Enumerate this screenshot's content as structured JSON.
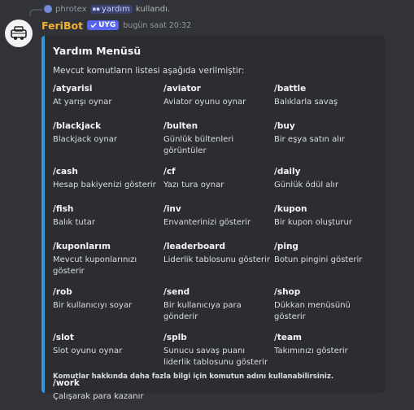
{
  "reply": {
    "user": "phrotex",
    "command": "yardım",
    "suffix": "kullandı."
  },
  "message": {
    "author": "FeriBot",
    "tag": "UYG",
    "timestamp": "bugün saat 20:32"
  },
  "embed": {
    "accent_color": "#3498db",
    "title": "Yardım Menüsü",
    "description": "Mevcut komutların listesi aşağıda verilmiştir:",
    "fields": [
      {
        "name": "/atyarisi",
        "value": "At yarışı oynar"
      },
      {
        "name": "/aviator",
        "value": "Aviator oyunu oynar"
      },
      {
        "name": "/battle",
        "value": "Balıklarla savaş"
      },
      {
        "name": "/blackjack",
        "value": "Blackjack oynar"
      },
      {
        "name": "/bulten",
        "value": "Günlük bültenleri görüntüler"
      },
      {
        "name": "/buy",
        "value": "Bir eşya satın alır"
      },
      {
        "name": "/cash",
        "value": "Hesap bakiyenizi gösterir"
      },
      {
        "name": "/cf",
        "value": "Yazı tura oynar"
      },
      {
        "name": "/daily",
        "value": "Günlük ödül alır"
      },
      {
        "name": "/fish",
        "value": "Balık tutar"
      },
      {
        "name": "/inv",
        "value": "Envanterinizi gösterir"
      },
      {
        "name": "/kupon",
        "value": "Bir kupon oluşturur"
      },
      {
        "name": "/kuponlarım",
        "value": "Mevcut kuponlarınızı gösterir"
      },
      {
        "name": "/leaderboard",
        "value": "Liderlik tablosunu gösterir"
      },
      {
        "name": "/ping",
        "value": "Botun pingini gösterir"
      },
      {
        "name": "/rob",
        "value": "Bir kullanıcıyı soyar"
      },
      {
        "name": "/send",
        "value": "Bir kullanıcıya para gönderir"
      },
      {
        "name": "/shop",
        "value": "Dükkan menüsünü gösterir"
      },
      {
        "name": "/slot",
        "value": "Slot oyunu oynar"
      },
      {
        "name": "/splb",
        "value": "Sunucu savaş puanı liderlik tablosunu gösterir"
      },
      {
        "name": "/team",
        "value": "Takımınızı gösterir"
      },
      {
        "name": "/work",
        "value": "Çalışarak para kazanır"
      }
    ],
    "footer": "Komutlar hakkında daha fazla bilgi için komutun adını kullanabilirsiniz."
  }
}
